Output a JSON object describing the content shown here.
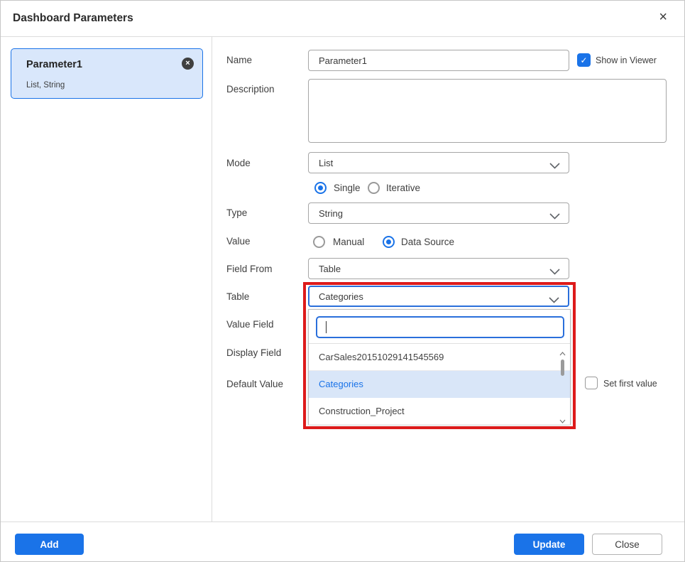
{
  "colors": {
    "accent": "#1a73e8",
    "accent_light": "#d9e7fb",
    "annotation": "#dd1a1a"
  },
  "dialog": {
    "title": "Dashboard Parameters",
    "close_icon": "×"
  },
  "parameter_card": {
    "title": "Parameter1",
    "subtitle": "List, String",
    "remove_icon": "×"
  },
  "form": {
    "name_label": "Name",
    "name_value": "Parameter1",
    "show_in_viewer_label": "Show in Viewer",
    "show_in_viewer_checked": true,
    "check_glyph": "✓",
    "description_label": "Description",
    "description_value": "",
    "mode_label": "Mode",
    "mode_value": "List",
    "single_label": "Single",
    "single_checked": true,
    "iterative_label": "Iterative",
    "iterative_checked": false,
    "type_label": "Type",
    "type_value": "String",
    "value_label": "Value",
    "manual_label": "Manual",
    "manual_checked": false,
    "data_source_label": "Data Source",
    "data_source_checked": true,
    "field_from_label": "Field From",
    "field_from_value": "Table",
    "table_label": "Table",
    "table_value": "Categories",
    "value_field_label": "Value Field",
    "display_field_label": "Display Field",
    "default_value_label": "Default Value",
    "set_first_value_label": "Set first value",
    "set_first_value_checked": false
  },
  "table_dropdown": {
    "search_value": "",
    "search_placeholder": "",
    "items": [
      {
        "label": "CarSales20151029141545569",
        "selected": false
      },
      {
        "label": "Categories",
        "selected": true
      },
      {
        "label": "Construction_Project",
        "selected": false
      }
    ]
  },
  "footer": {
    "add": "Add",
    "update": "Update",
    "close": "Close"
  }
}
